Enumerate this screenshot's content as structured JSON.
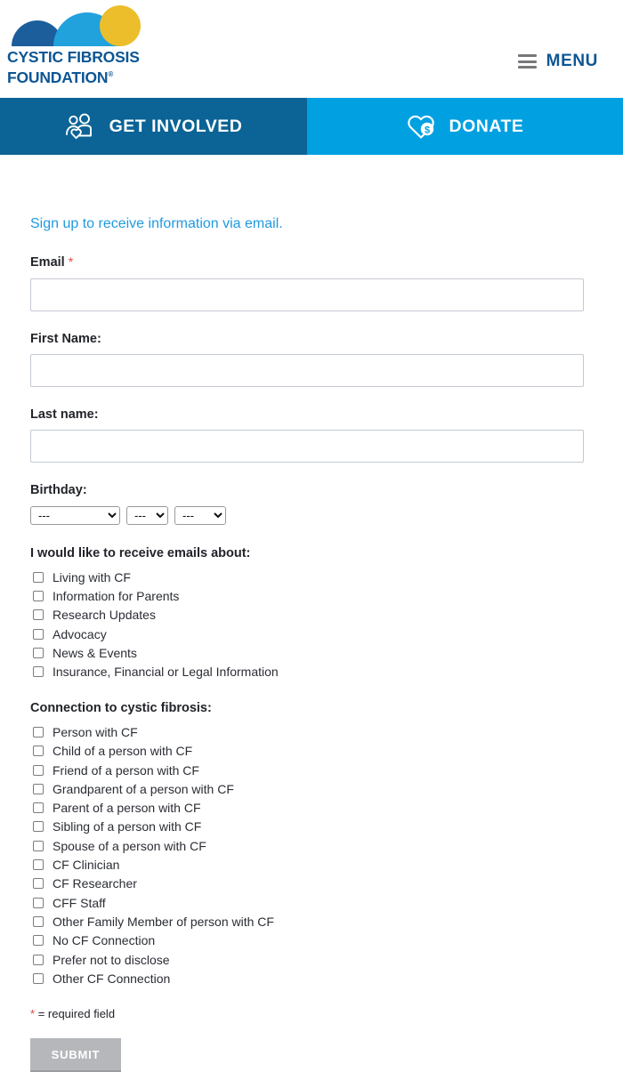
{
  "header": {
    "logo": {
      "line1": "CYSTIC FIBROSIS",
      "line2": "FOUNDATION",
      "registered_mark": "®",
      "colors": {
        "dome_dark": "#1C5E9C",
        "dome_light": "#22A2DD",
        "circle_yellow": "#EDBE2B",
        "wordmark_blue": "#0D5694"
      }
    },
    "menu": {
      "label": "MENU",
      "icon": "hamburger-icon"
    }
  },
  "navbar": {
    "get_involved": {
      "label": "GET INVOLVED",
      "icon": "people-heart-icon",
      "background": "#0B6396"
    },
    "donate": {
      "label": "DONATE",
      "icon": "heart-dollar-icon",
      "background": "#00A0E1"
    }
  },
  "form": {
    "intro": "Sign up to receive information via email.",
    "required_marker": "*",
    "fields": {
      "email": {
        "label": "Email",
        "required": true,
        "value": "",
        "placeholder": ""
      },
      "first_name": {
        "label": "First Name:",
        "required": false,
        "value": "",
        "placeholder": ""
      },
      "last_name": {
        "label": "Last name:",
        "required": false,
        "value": "",
        "placeholder": ""
      },
      "birthday": {
        "label": "Birthday:",
        "day": {
          "selected": "---",
          "options": [
            "---"
          ]
        },
        "month": {
          "selected": "---",
          "options": [
            "---"
          ]
        },
        "year": {
          "selected": "---",
          "options": [
            "---"
          ]
        }
      }
    },
    "email_topics": {
      "title": "I would like to receive emails about:",
      "options": [
        {
          "label": "Living with CF",
          "checked": false
        },
        {
          "label": "Information for Parents",
          "checked": false
        },
        {
          "label": "Research Updates",
          "checked": false
        },
        {
          "label": "Advocacy",
          "checked": false
        },
        {
          "label": "News & Events",
          "checked": false
        },
        {
          "label": "Insurance, Financial or Legal Information",
          "checked": false
        }
      ]
    },
    "connection": {
      "title": "Connection to cystic fibrosis:",
      "options": [
        {
          "label": "Person with CF",
          "checked": false
        },
        {
          "label": "Child of a person with CF",
          "checked": false
        },
        {
          "label": "Friend of a person with CF",
          "checked": false
        },
        {
          "label": "Grandparent of a person with CF",
          "checked": false
        },
        {
          "label": "Parent of a person with CF",
          "checked": false
        },
        {
          "label": "Sibling of a person with CF",
          "checked": false
        },
        {
          "label": "Spouse of a person with CF",
          "checked": false
        },
        {
          "label": "CF Clinician",
          "checked": false
        },
        {
          "label": "CF Researcher",
          "checked": false
        },
        {
          "label": "CFF Staff",
          "checked": false
        },
        {
          "label": "Other Family Member of person with CF",
          "checked": false
        },
        {
          "label": "No CF Connection",
          "checked": false
        },
        {
          "label": "Prefer not to disclose",
          "checked": false
        },
        {
          "label": "Other CF Connection",
          "checked": false
        }
      ]
    },
    "required_note": "= required field",
    "submit_label": "SUBMIT"
  }
}
